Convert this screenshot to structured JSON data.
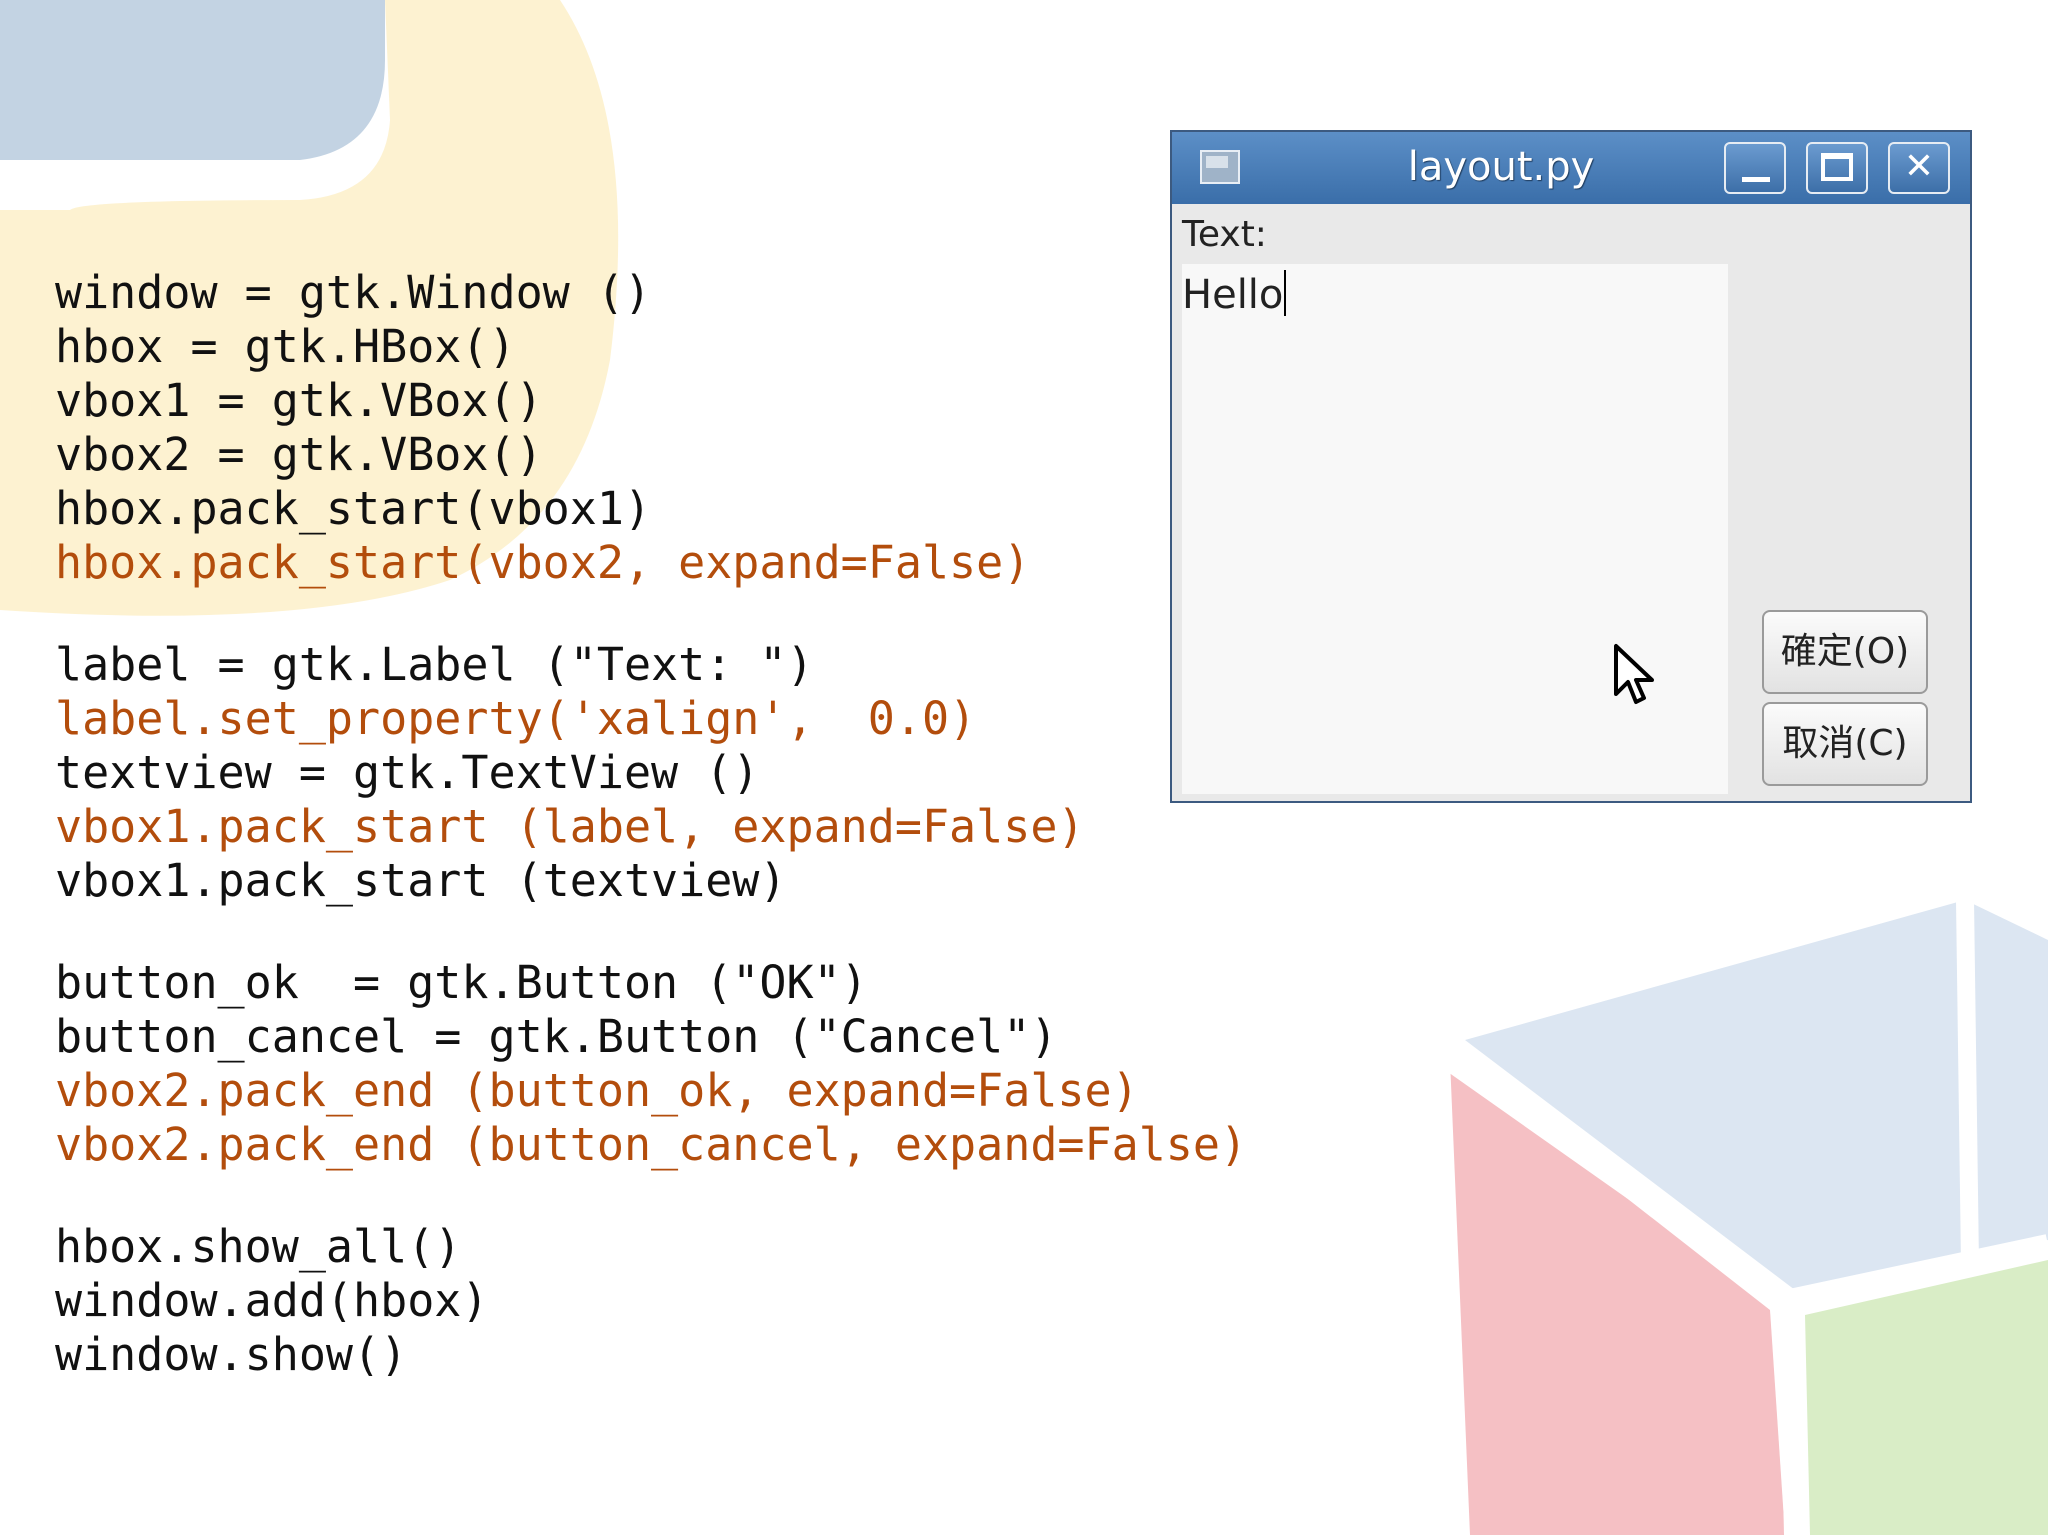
{
  "code": {
    "blocks": [
      [
        {
          "text": "window = gtk.Window ()",
          "highlight": false
        },
        {
          "text": "hbox = gtk.HBox()",
          "highlight": false
        },
        {
          "text": "vbox1 = gtk.VBox()",
          "highlight": false
        },
        {
          "text": "vbox2 = gtk.VBox()",
          "highlight": false
        },
        {
          "text": "hbox.pack_start(vbox1)",
          "highlight": false
        },
        {
          "text": "hbox.pack_start(vbox2, expand=False)",
          "highlight": true
        }
      ],
      [
        {
          "text": "label = gtk.Label (\"Text: \")",
          "highlight": false
        },
        {
          "text": "label.set_property('xalign',  0.0)",
          "highlight": true
        },
        {
          "text": "textview = gtk.TextView ()",
          "highlight": false
        },
        {
          "text": "vbox1.pack_start (label, expand=False)",
          "highlight": true
        },
        {
          "text": "vbox1.pack_start (textview)",
          "highlight": false
        }
      ],
      [
        {
          "text": "button_ok  = gtk.Button (\"OK\")",
          "highlight": false
        },
        {
          "text": "button_cancel = gtk.Button (\"Cancel\")",
          "highlight": false
        },
        {
          "text": "vbox2.pack_end (button_ok, expand=False)",
          "highlight": true
        },
        {
          "text": "vbox2.pack_end (button_cancel, expand=False)",
          "highlight": true
        }
      ],
      [
        {
          "text": "hbox.show_all()",
          "highlight": false
        },
        {
          "text": "window.add(hbox)",
          "highlight": false
        },
        {
          "text": "window.show()",
          "highlight": false
        }
      ]
    ]
  },
  "window": {
    "title": "layout.py",
    "minimize_glyph": "",
    "maximize_glyph": "",
    "close_glyph": "✕",
    "label_text": "Text:",
    "textview_value": "Hello",
    "ok_button": "確定(O)",
    "cancel_button": "取消(C)"
  },
  "colors": {
    "code_text": "#111111",
    "code_highlight": "#b34d0c",
    "titlebar": "#4a7fbb"
  }
}
